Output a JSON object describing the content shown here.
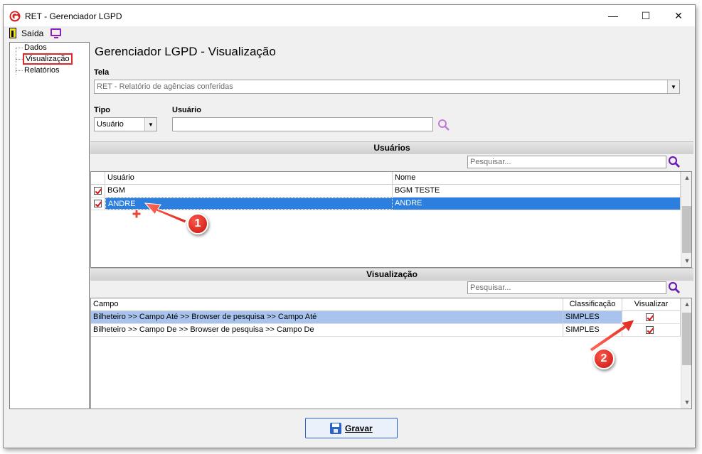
{
  "window": {
    "title": "RET - Gerenciador LGPD",
    "minimize": "—",
    "maximize": "☐",
    "close": "✕"
  },
  "toolbar": {
    "exit_label": "Saída"
  },
  "tree": {
    "items": [
      "Dados",
      "Visualização",
      "Relatórios"
    ],
    "selected": "Visualização"
  },
  "main": {
    "title": "Gerenciador LGPD - Visualização",
    "tela_label": "Tela",
    "tela_value": "RET - Relatório de agências conferidas",
    "tipo_label": "Tipo",
    "tipo_value": "Usuário",
    "usuario_label": "Usuário",
    "usuario_value": ""
  },
  "users_section": {
    "title": "Usuários",
    "search_placeholder": "Pesquisar...",
    "columns": [
      "Usuário",
      "Nome"
    ],
    "rows": [
      {
        "checked": true,
        "usuario": "BGM",
        "nome": "BGM TESTE"
      },
      {
        "checked": true,
        "usuario": "ANDRE",
        "nome": "ANDRE"
      }
    ]
  },
  "view_section": {
    "title": "Visualização",
    "search_placeholder": "Pesquisar...",
    "columns": [
      "Campo",
      "Classificação",
      "Visualizar"
    ],
    "rows": [
      {
        "campo": "Bilheteiro >> Campo Até >> Browser de pesquisa >> Campo Até",
        "classificacao": "SIMPLES",
        "visualizar": true
      },
      {
        "campo": "Bilheteiro >> Campo De >> Browser de pesquisa >> Campo De",
        "classificacao": "SIMPLES",
        "visualizar": true
      }
    ]
  },
  "footer": {
    "save_label": "Gravar"
  },
  "callouts": [
    "1",
    "2"
  ],
  "colors": {
    "selection": "#2c7fde",
    "highlight": "#a8c4ee",
    "callout": "#d8231a",
    "accent": "#8b1fb8"
  }
}
